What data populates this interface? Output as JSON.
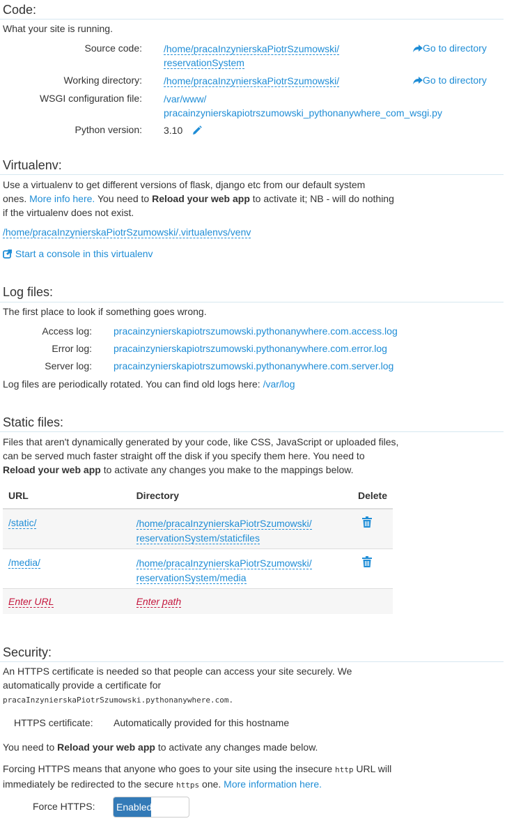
{
  "code": {
    "heading": "Code:",
    "intro": "What your site is running.",
    "source_label": "Source code:",
    "source_line1": "/home/pracaInzynierskaPiotrSzumowski/",
    "source_line2": "reservationSystem",
    "go_dir_1": "Go to directory",
    "workdir_label": "Working directory:",
    "workdir_value": "/home/pracaInzynierskaPiotrSzumowski/",
    "go_dir_2": "Go to directory",
    "wsgi_label": "WSGI configuration file:",
    "wsgi_line1": "/var/www/",
    "wsgi_line2": "pracainzynierskapiotrszumowski_pythonanywhere_com_wsgi.py",
    "python_label": "Python version:",
    "python_value": "3.10"
  },
  "virtualenv": {
    "heading": "Virtualenv:",
    "desc1": "Use a virtualenv to get different versions of flask, django etc from our default system",
    "desc2_pre": "ones.",
    "desc2_link": "More info here.",
    "desc2_mid": "You need to",
    "desc2_bold": "Reload your web app",
    "desc2_post": "to activate it; NB - will do nothing",
    "desc3": "if the virtualenv does not exist.",
    "path": "/home/pracaInzynierskaPiotrSzumowski/.virtualenvs/venv",
    "console_link": "Start a console in this virtualenv"
  },
  "logs": {
    "heading": "Log files:",
    "intro": "The first place to look if something goes wrong.",
    "access_label": "Access log:",
    "access_value": "pracainzynierskapiotrszumowski.pythonanywhere.com.access.log",
    "error_label": "Error log:",
    "error_value": "pracainzynierskapiotrszumowski.pythonanywhere.com.error.log",
    "server_label": "Server log:",
    "server_value": "pracainzynierskapiotrszumowski.pythonanywhere.com.server.log",
    "rotated_text": "Log files are periodically rotated. You can find old logs here:",
    "rotated_link": "/var/log"
  },
  "static": {
    "heading": "Static files:",
    "desc1": "Files that aren't dynamically generated by your code, like CSS, JavaScript or uploaded files,",
    "desc2": "can be served much faster straight off the disk if you specify them here. You need to",
    "desc3_bold": "Reload your web app",
    "desc3_post": "to activate any changes you make to the mappings below.",
    "columns": [
      "URL",
      "Directory",
      "Delete"
    ],
    "rows": [
      {
        "url": "/static/",
        "dir1": "/home/pracaInzynierskaPiotrSzumowski/",
        "dir2": "reservationSystem/staticfiles"
      },
      {
        "url": "/media/",
        "dir1": "/home/pracaInzynierskaPiotrSzumowski/",
        "dir2": "reservationSystem/media"
      }
    ],
    "url_placeholder": "Enter URL",
    "path_placeholder": "Enter path"
  },
  "security": {
    "heading": "Security:",
    "desc1": "An HTTPS certificate is needed so that people can access your site securely. We",
    "desc2": "automatically provide a certificate for",
    "hostname": "pracaInzynierskaPiotrSzumowski.pythonanywhere.com.",
    "cert_label": "HTTPS certificate:",
    "cert_value": "Automatically provided for this hostname",
    "reload_pre": "You need to",
    "reload_bold": "Reload your web app",
    "reload_post": "to activate any changes made below.",
    "force_p1": "Forcing HTTPS means that anyone who goes to your site using the insecure",
    "force_code1": "http",
    "force_p2": "URL will",
    "force_p3": "immediately be redirected to the secure",
    "force_code2": "https",
    "force_p4": "one.",
    "force_link": "More information here.",
    "force_label": "Force HTTPS:",
    "force_state": "Enabled"
  }
}
